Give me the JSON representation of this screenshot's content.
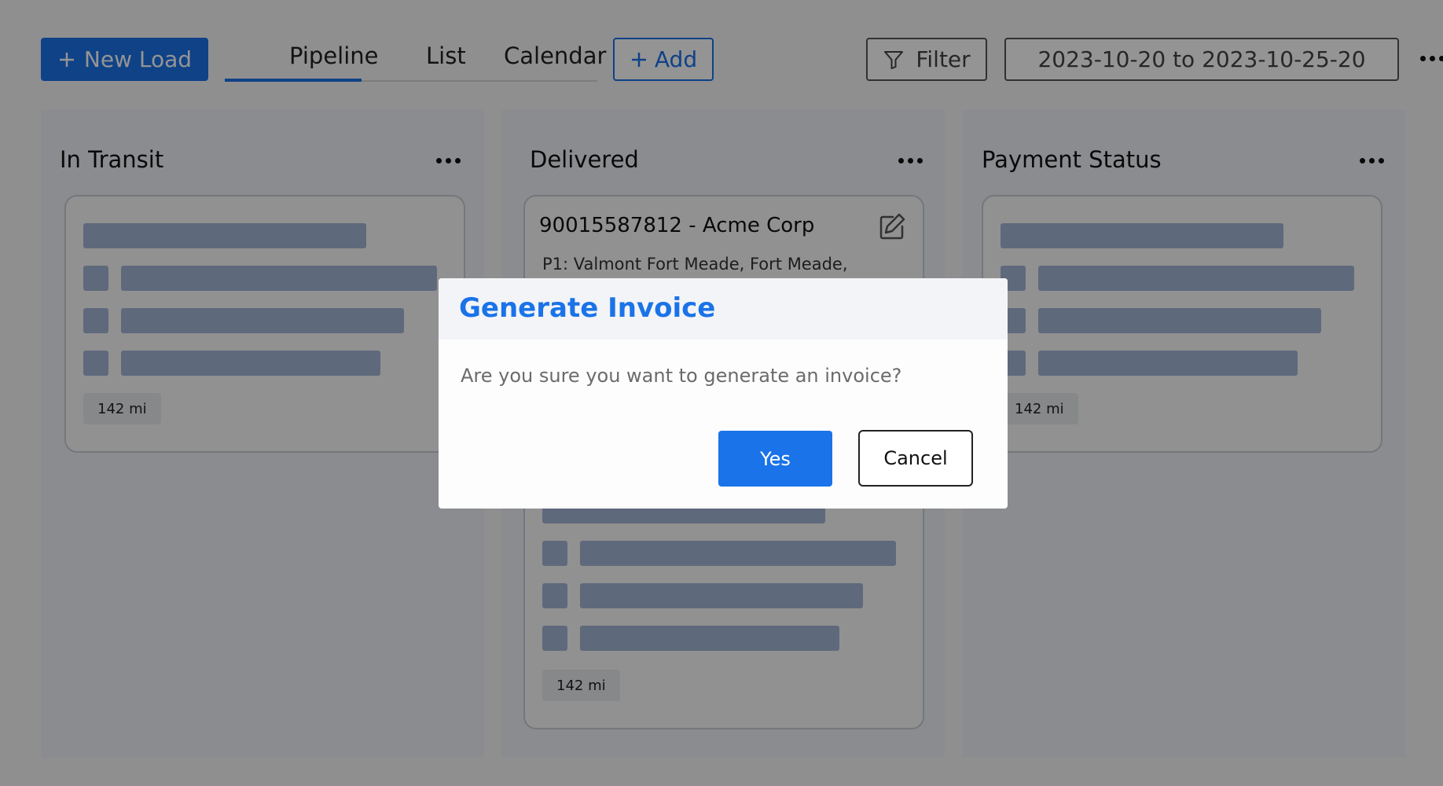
{
  "toolbar": {
    "new_load_label": "New Load",
    "tabs": [
      {
        "label": "Pipeline"
      },
      {
        "label": "List"
      },
      {
        "label": "Calendar"
      }
    ],
    "add_label": "Add",
    "filter_label": "Filter",
    "date_range": "2023-10-20 to 2023-10-25-20"
  },
  "columns": [
    {
      "title": "In Transit",
      "card": {
        "distance": "142 mi"
      }
    },
    {
      "title": "Delivered",
      "card": {
        "load_title": "90015587812 - Acme Corp",
        "pickup": "P1: Valmont Fort Meade, Fort Meade,",
        "distance": "142 mi"
      }
    },
    {
      "title": "Payment Status",
      "card": {
        "distance": "142 mi"
      }
    }
  ],
  "modal": {
    "title": "Generate Invoice",
    "message": "Are you sure you want to generate an invoice?",
    "confirm_label": "Yes",
    "cancel_label": "Cancel"
  },
  "colors": {
    "accent": "#1a73e8",
    "skeleton": "#a4b5d6",
    "column_bg": "#eef1f6"
  }
}
